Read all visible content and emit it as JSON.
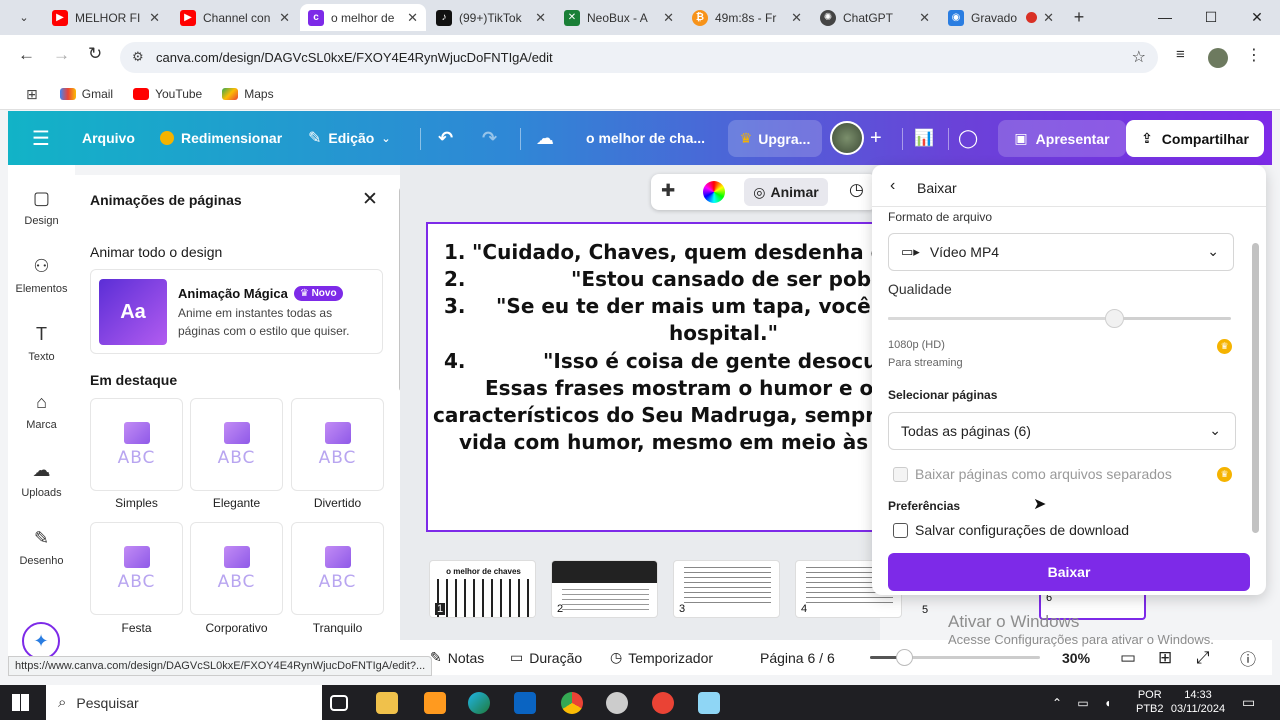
{
  "browser": {
    "tabs": [
      {
        "title": "MELHOR FI",
        "color": "#ff0000",
        "icon": "youtube-icon"
      },
      {
        "title": "Channel con",
        "color": "#ff0000",
        "icon": "youtube-icon"
      },
      {
        "title": "o melhor de",
        "color": "#7d2ae8",
        "icon": "canva-icon"
      },
      {
        "title": "(99+)TikTok",
        "color": "#111111",
        "icon": "tiktok-icon"
      },
      {
        "title": "NeoBux - A",
        "color": "#1a7f37",
        "icon": "neobux-icon"
      },
      {
        "title": "49m:8s - Fr",
        "color": "#f7931a",
        "icon": "bitcoin-icon"
      },
      {
        "title": "ChatGPT",
        "color": "#444444",
        "icon": "chatgpt-icon"
      },
      {
        "title": "Gravado",
        "color": "#2a7de1",
        "icon": "recorder-icon"
      }
    ],
    "url": "canva.com/design/DAGVcSL0kxE/FXOY4E4RynWjucDoFNTIgA/edit",
    "bookmarks": [
      "Gmail",
      "YouTube",
      "Maps"
    ],
    "status_url": "https://www.canva.com/design/DAGVcSL0kxE/FXOY4E4RynWjucDoFNTIgA/edit?..."
  },
  "canva_header": {
    "arquivo": "Arquivo",
    "redimensionar": "Redimensionar",
    "edicao": "Edição",
    "design_title": "o melhor de cha...",
    "upgrade": "Upgra...",
    "apresentar": "Apresentar",
    "compartilhar": "Compartilhar"
  },
  "rail": [
    "Design",
    "Elementos",
    "Texto",
    "Marca",
    "Uploads",
    "Desenho"
  ],
  "panel": {
    "title": "Animações de páginas",
    "animate_all": "Animar todo o design",
    "magic_title": "Animação Mágica",
    "magic_badge": "Novo",
    "magic_desc_1": "Anime em instantes todas as",
    "magic_desc_2": "páginas com o estilo que quiser.",
    "featured": "Em destaque",
    "cards": [
      "Simples",
      "Elegante",
      "Divertido",
      "Festa",
      "Corporativo",
      "Tranquilo"
    ],
    "card_text": "ABC"
  },
  "floatbar": {
    "animar": "Animar"
  },
  "page_text": {
    "l1n": "1.",
    "l1": "\"Cuidado, Chaves, quem desdenha quer co",
    "l2n": "2.",
    "l2": "\"Estou cansado de ser pobre!\"",
    "l3n": "3.",
    "l3": "\"Se eu te der mais um tapa, você vai pa",
    "l3b": "hospital.\"",
    "l4n": "4.",
    "l4": "\"Isso é coisa de gente desocupada",
    "p1": "Essas frases mostram o humor e o sarca",
    "p2": "característicos do Seu Madruga, sempre enfre",
    "p3": "vida com humor, mesmo em meio às dificu"
  },
  "thumbs": [
    {
      "n": "1",
      "caption": "o melhor de chaves"
    },
    {
      "n": "2",
      "caption": ""
    },
    {
      "n": "3",
      "caption": ""
    },
    {
      "n": "4",
      "caption": ""
    },
    {
      "n": "5",
      "caption": ""
    },
    {
      "n": "6",
      "caption": ""
    }
  ],
  "bottombar": {
    "notas": "Notas",
    "duracao": "Duração",
    "temporizador": "Temporizador",
    "pagina": "Página 6 / 6",
    "zoom": "30%",
    "zoom_level": 0.2
  },
  "download": {
    "title": "Baixar",
    "formato_label": "Formato de arquivo",
    "formato_value": "Vídeo MP4",
    "qualidade_label": "Qualidade",
    "quality_level": 0.66,
    "quality_value": "1080p (HD)",
    "quality_note": "Para streaming",
    "paginas_label": "Selecionar páginas",
    "paginas_value": "Todas as páginas (6)",
    "separados": "Baixar páginas como arquivos separados",
    "preferencias": "Preferências",
    "salvar": "Salvar configurações de download",
    "button": "Baixar"
  },
  "watermark": {
    "title": "Ativar o Windows",
    "subtitle": "Acesse Configurações para ativar o Windows."
  },
  "taskbar": {
    "search": "Pesquisar",
    "lang1": "POR",
    "lang2": "PTB2",
    "time": "14:33",
    "date": "03/11/2024"
  },
  "colors": {
    "canva_purple": "#7d2ae8",
    "crown": "#f5b300"
  }
}
